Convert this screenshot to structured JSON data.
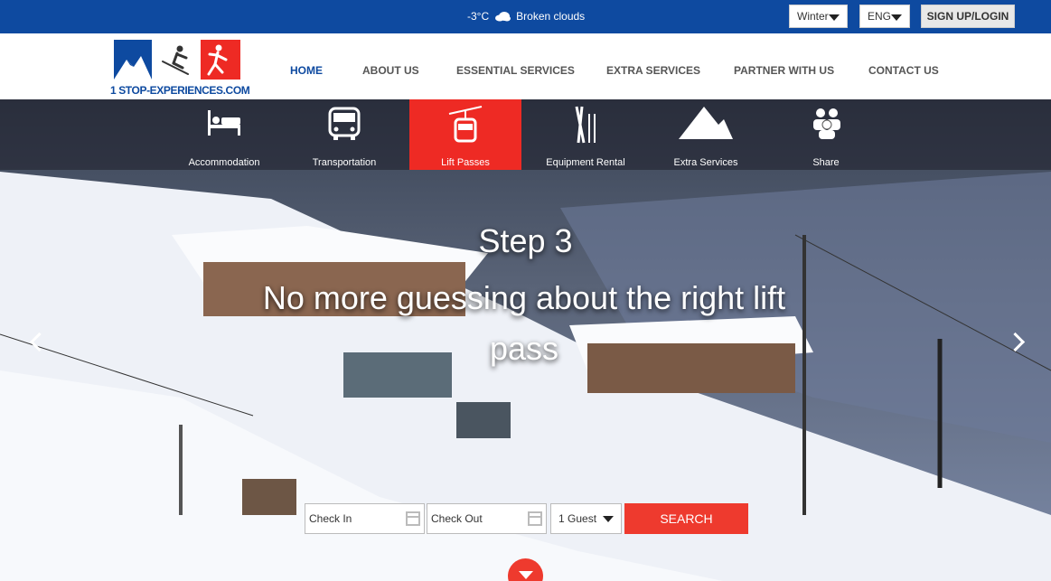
{
  "topbar": {
    "temperature": "-3°C",
    "weather": "Broken clouds",
    "season": "Winter",
    "language": "ENG",
    "signup": "SIGN UP/LOGIN"
  },
  "logo": {
    "text": "1 STOP-EXPERIENCES.COM"
  },
  "nav": [
    "HOME",
    "ABOUT US",
    "ESSENTIAL SERVICES",
    "EXTRA SERVICES",
    "PARTNER WITH US",
    "CONTACT US"
  ],
  "categories": [
    "Accommodation",
    "Transportation",
    "Lift Passes",
    "Equipment Rental",
    "Extra Services",
    "Share"
  ],
  "hero": {
    "step": "Step 3",
    "text": "No more guessing about the right lift pass"
  },
  "booking": {
    "checkin_placeholder": "Check In",
    "checkout_placeholder": "Check Out",
    "guests": "1 Guest",
    "search": "SEARCH"
  },
  "colors": {
    "brand_blue": "#0e4aa0",
    "accent_red": "#ee2a24"
  }
}
